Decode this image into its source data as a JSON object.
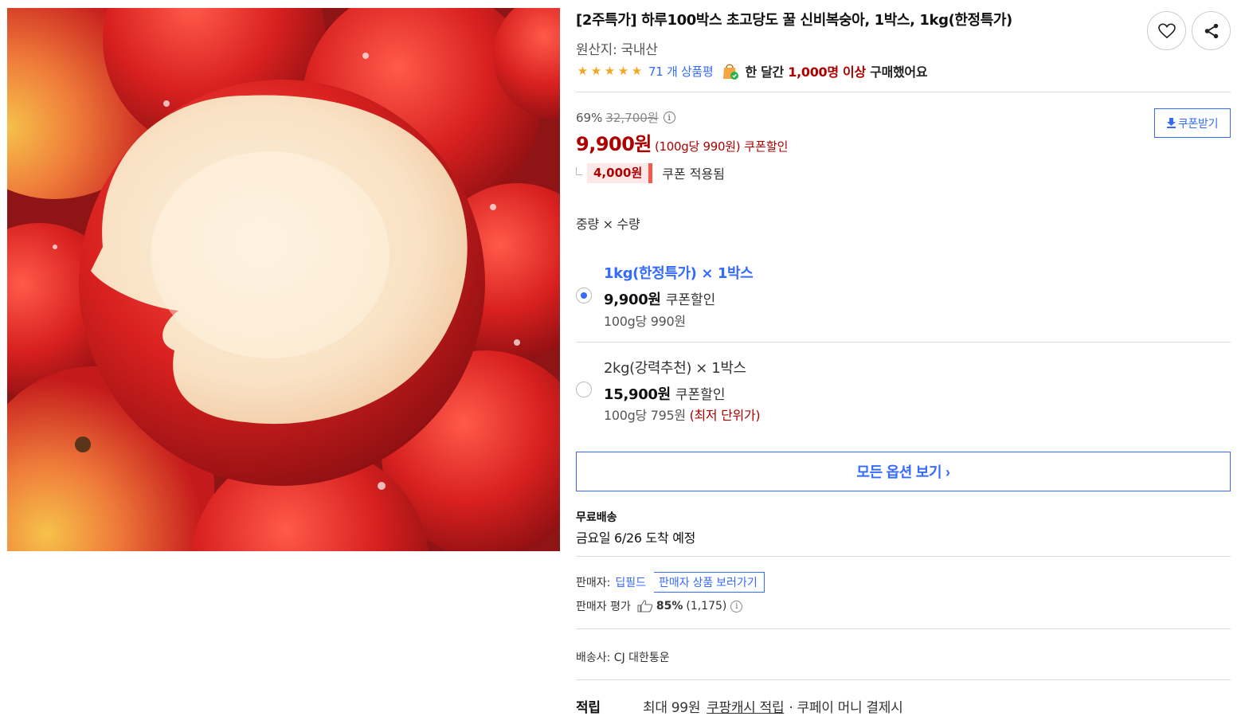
{
  "product": {
    "title": "[2주특가] 하루100박스 초고당도 꿀 신비복숭아, 1박스, 1kg(한정특가)",
    "origin": "원산지: 국내산",
    "image_alt": "신비복숭아"
  },
  "rating": {
    "stars": 5,
    "star_char": "★",
    "review_count_text": "71 개 상품평",
    "monthly_prefix": "한 달간",
    "monthly_highlight": "1,000명 이상",
    "monthly_suffix": "구매했어요"
  },
  "actions": {
    "wish_icon": "heart-icon",
    "share_icon": "share-icon"
  },
  "price": {
    "discount_rate": "69%",
    "original_price": "32,700원",
    "info_symbol": "i",
    "sale_price": "9,900원",
    "unit_price": "(100g당 990원)",
    "coupon_discount": "쿠폰할인",
    "coupon_amount": "4,000원",
    "coupon_applied": "쿠폰 적용됨",
    "coupon_button": "쿠폰받기"
  },
  "options": {
    "label": "중량 × 수량",
    "items": [
      {
        "name": "1kg(한정특가) × 1박스",
        "price": "9,900원",
        "coupon": "쿠폰할인",
        "unit": "100g당 990원",
        "lowest": "",
        "selected": true
      },
      {
        "name": "2kg(강력추천) × 1박스",
        "price": "15,900원",
        "coupon": "쿠폰할인",
        "unit": "100g당 795원",
        "lowest": "(최저 단위가)",
        "selected": false
      }
    ],
    "all_button": "모든 옵션 보기 ›"
  },
  "shipping": {
    "label": "무료배송",
    "eta": "금요일 6/26 도착 예정"
  },
  "seller": {
    "label": "판매자:",
    "name": "딥필드",
    "button": "판매자 상품 보러가기",
    "rating_label": "판매자 평가",
    "rating_pct": "85%",
    "rating_count": "(1,175)",
    "info_symbol": "i"
  },
  "courier": {
    "text": "배송사: CJ 대한통운"
  },
  "reward": {
    "title": "적립",
    "prefix": "최대 99원",
    "link": "쿠팡캐시 적립",
    "suffix": "· 쿠페이 머니 결제시"
  },
  "colors": {
    "accent_blue": "#346aff",
    "price_red": "#ae0000",
    "star": "#f5a623"
  }
}
